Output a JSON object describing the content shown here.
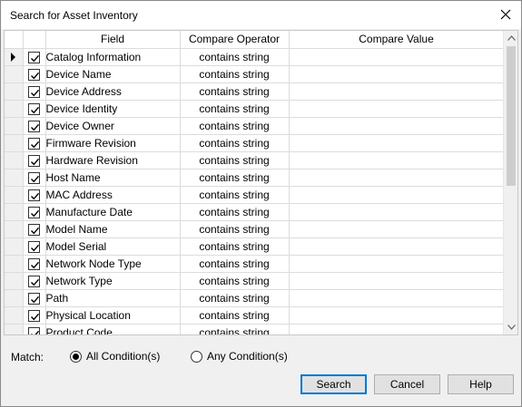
{
  "window": {
    "title": "Search for Asset Inventory"
  },
  "grid": {
    "columns": {
      "field": "Field",
      "operator": "Compare Operator",
      "value": "Compare Value"
    },
    "rows": [
      {
        "field": "Catalog Information",
        "operator": "contains string",
        "value": ""
      },
      {
        "field": "Device Name",
        "operator": "contains string",
        "value": ""
      },
      {
        "field": "Device Address",
        "operator": "contains string",
        "value": ""
      },
      {
        "field": "Device Identity",
        "operator": "contains string",
        "value": ""
      },
      {
        "field": "Device Owner",
        "operator": "contains string",
        "value": ""
      },
      {
        "field": "Firmware Revision",
        "operator": "contains string",
        "value": ""
      },
      {
        "field": "Hardware Revision",
        "operator": "contains string",
        "value": ""
      },
      {
        "field": "Host Name",
        "operator": "contains string",
        "value": ""
      },
      {
        "field": "MAC Address",
        "operator": "contains string",
        "value": ""
      },
      {
        "field": "Manufacture Date",
        "operator": "contains string",
        "value": ""
      },
      {
        "field": "Model Name",
        "operator": "contains string",
        "value": ""
      },
      {
        "field": "Model Serial",
        "operator": "contains string",
        "value": ""
      },
      {
        "field": "Network Node Type",
        "operator": "contains string",
        "value": ""
      },
      {
        "field": "Network Type",
        "operator": "contains string",
        "value": ""
      },
      {
        "field": "Path",
        "operator": "contains string",
        "value": ""
      },
      {
        "field": "Physical Location",
        "operator": "contains string",
        "value": ""
      },
      {
        "field": "Product Code",
        "operator": "contains string",
        "value": ""
      }
    ]
  },
  "match": {
    "label": "Match:",
    "all_label": "All Condition(s)",
    "any_label": "Any Condition(s)",
    "selected": "all"
  },
  "buttons": {
    "search": "Search",
    "cancel": "Cancel",
    "help": "Help"
  }
}
